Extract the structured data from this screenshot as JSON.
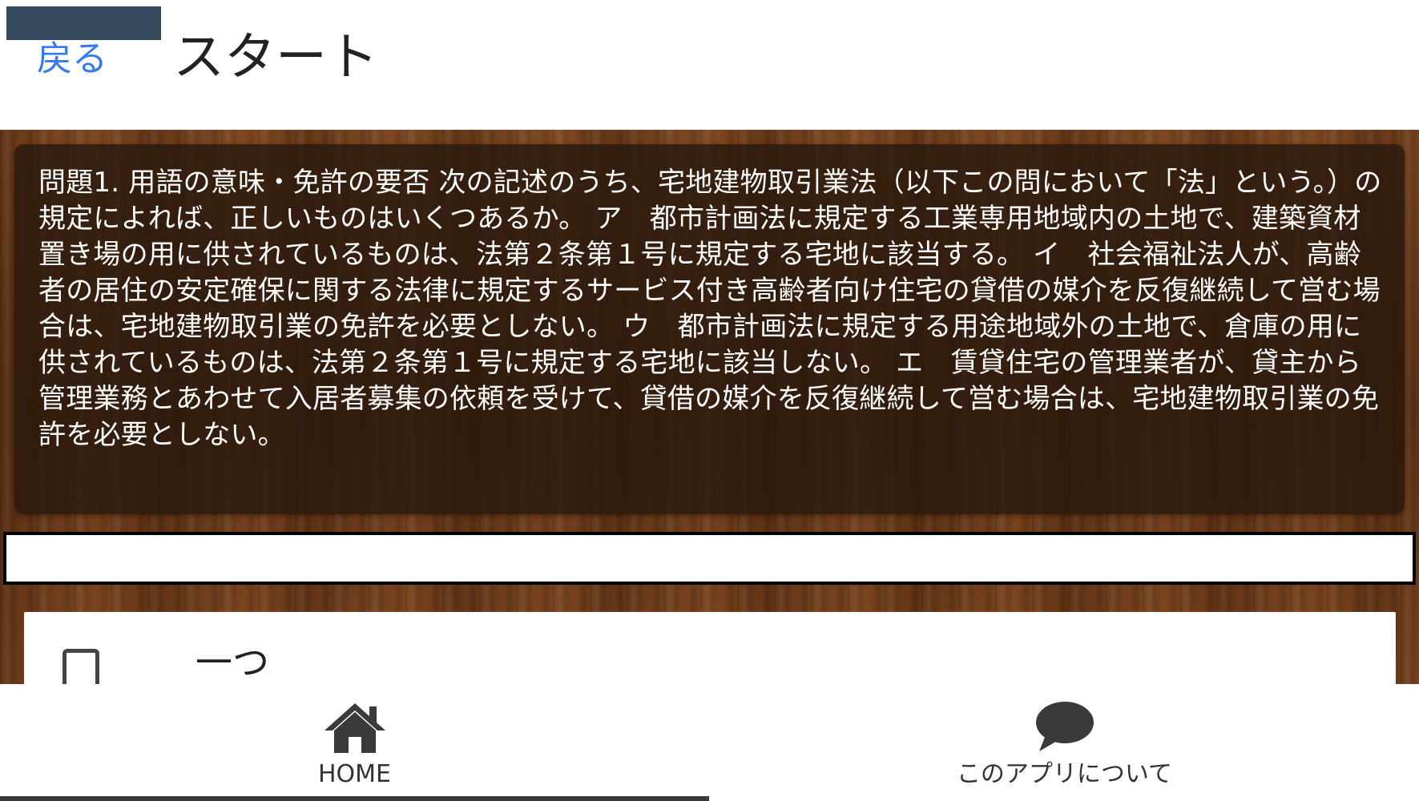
{
  "header": {
    "back_label": "戻る",
    "title": "スタート"
  },
  "question": {
    "text": "問題1. 用語の意味・免許の要否 次の記述のうち、宅地建物取引業法（以下この問において「法」という。）の規定によれば、正しいものはいくつあるか。 ア　都市計画法に規定する工業専用地域内の土地で、建築資材置き場の用に供されているものは、法第２条第１号に規定する宅地に該当する。 イ　社会福祉法人が、高齢者の居住の安定確保に関する法律に規定するサービス付き高齢者向け住宅の貸借の媒介を反復継続して営む場合は、宅地建物取引業の免許を必要としない。 ウ　都市計画法に規定する用途地域外の土地で、倉庫の用に供されているものは、法第２条第１号に規定する宅地に該当しない。 エ　賃貸住宅の管理業者が、貸主から管理業務とあわせて入居者募集の依頼を受けて、貸借の媒介を反復継続して営む場合は、宅地建物取引業の免許を必要としない。"
  },
  "progress": {
    "fraction": 0.11,
    "fill_color": "#34495e"
  },
  "answers": [
    {
      "label": "一つ",
      "checked": false
    }
  ],
  "bottom_nav": {
    "items": [
      {
        "label": "HOME",
        "icon": "home-icon",
        "active": true
      },
      {
        "label": "このアプリについて",
        "icon": "speech-bubble-icon",
        "active": false
      }
    ]
  },
  "colors": {
    "link": "#3478f6",
    "question_bg": "#28180c",
    "wood": "#6b3e1f"
  }
}
